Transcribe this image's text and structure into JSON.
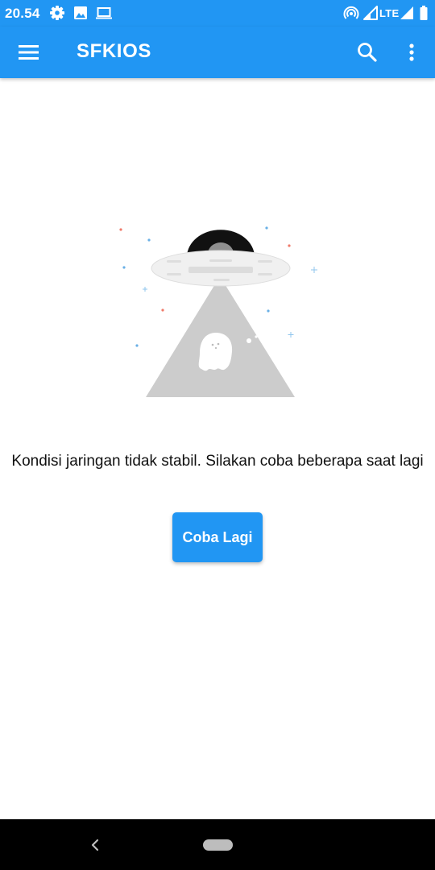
{
  "status_bar": {
    "time": "20.54",
    "network_label": "LTE",
    "icons": [
      "settings-icon",
      "image-icon",
      "laptop-icon",
      "hotspot-icon",
      "signal-icon",
      "signal-icon",
      "battery-icon"
    ]
  },
  "app_bar": {
    "title": "SFKIOS",
    "icons": [
      "menu-icon",
      "search-icon",
      "more-vert-icon"
    ]
  },
  "main": {
    "illustration": "ufo-ghost-icon",
    "message": "Kondisi jaringan tidak stabil. Silakan coba beberapa saat lagi",
    "retry_label": "Coba Lagi"
  },
  "nav_bar": {
    "icons": [
      "back-icon",
      "home-pill-icon"
    ]
  },
  "colors": {
    "primary": "#2196f3",
    "text": "#111111",
    "nav_background": "#000000"
  }
}
